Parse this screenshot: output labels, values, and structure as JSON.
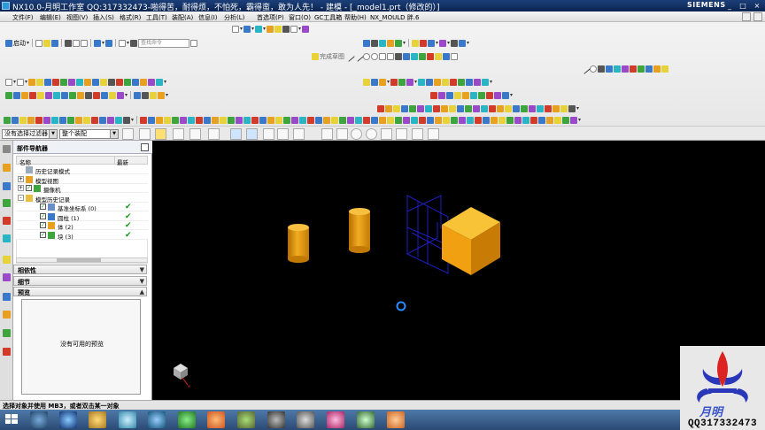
{
  "window": {
    "title": "NX10.0-月明工作室 QQ:317332473-啪得苦，耐得烦，不怕死，霸得蛮，敢为人先！ - 建模 - [_model1.prt（修改的）]",
    "brand": "SIEMENS",
    "controls": [
      "_",
      "□",
      "×"
    ]
  },
  "menubar": {
    "items": [
      "文件(F)",
      "编辑(E)",
      "视图(V)",
      "插入(S)",
      "格式(R)",
      "工具(T)",
      "装配(A)",
      "信息(I)",
      "分析(L)",
      "首选项(P)",
      "窗口(O)",
      "GC工具箱",
      "帮助(H)",
      "NX_MOULD 胖.6"
    ]
  },
  "toolbar": {
    "start_label": "启动",
    "search_placeholder": "查找命令",
    "sketch_label": "完成草图"
  },
  "filterbar": {
    "selection_filter": "没有选择过滤器",
    "assembly_scope": "整个装配"
  },
  "part_navigator": {
    "title": "部件导航器",
    "columns": [
      "名称",
      "最新"
    ],
    "rows": [
      {
        "label": "历史记录模式",
        "indent": 0,
        "expander": "",
        "checked": false,
        "latest": false,
        "icon": "history-mode-icon"
      },
      {
        "label": "模型视图",
        "indent": 0,
        "expander": "+",
        "checked": false,
        "latest": false,
        "icon": "model-views-icon"
      },
      {
        "label": "摄像机",
        "indent": 0,
        "expander": "+",
        "checked": true,
        "latest": false,
        "icon": "camera-icon"
      },
      {
        "label": "模型历史记录",
        "indent": 0,
        "expander": "-",
        "checked": false,
        "latest": false,
        "icon": "model-history-icon"
      },
      {
        "label": "基准坐标系 (0)",
        "indent": 1,
        "expander": "",
        "checked": true,
        "latest": true,
        "icon": "datum-csys-icon"
      },
      {
        "label": "圆柱 (1)",
        "indent": 1,
        "expander": "",
        "checked": true,
        "latest": true,
        "icon": "cylinder-icon"
      },
      {
        "label": "体 (2)",
        "indent": 1,
        "expander": "",
        "checked": true,
        "latest": true,
        "icon": "body-icon"
      },
      {
        "label": "块 (3)",
        "indent": 1,
        "expander": "",
        "checked": true,
        "latest": true,
        "icon": "block-icon"
      }
    ],
    "panels": [
      "相依性",
      "细节",
      "预览"
    ],
    "preview_message": "没有可用的预览"
  },
  "statusbar": {
    "prompt": "选择对象并使用 MB3，或者双击某一对象"
  },
  "watermark": {
    "name": "月明",
    "qq": "QQ317332473"
  },
  "colors": {
    "solid_orange": "#f0a010",
    "csys_blue": "#1e1ebe",
    "viewport_bg": "#000000",
    "tick_green": "#1a9a1a"
  }
}
